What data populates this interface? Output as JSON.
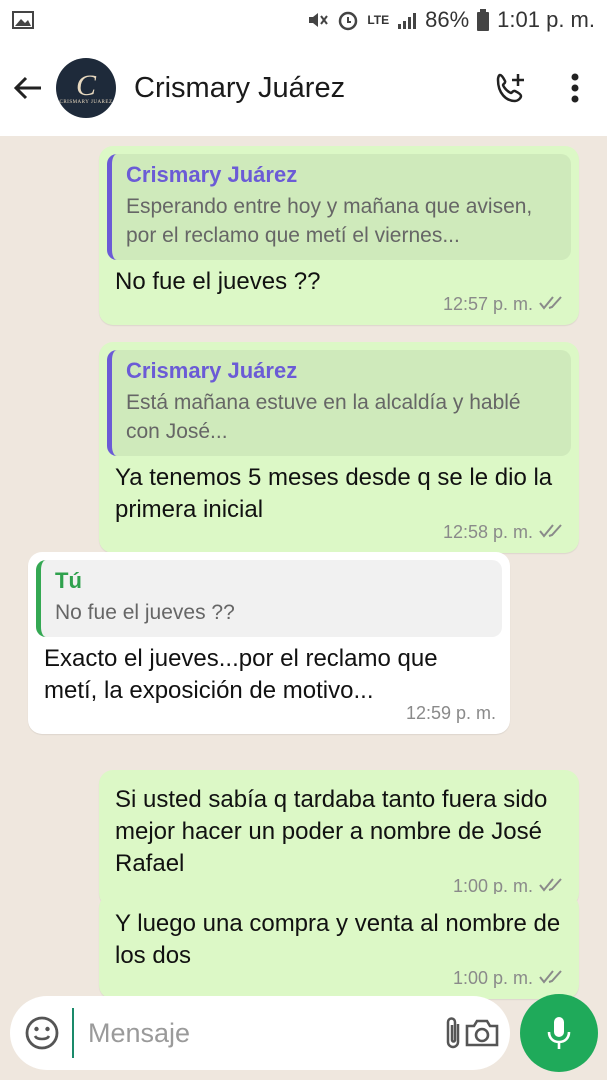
{
  "status_bar": {
    "battery": "86%",
    "time": "1:01 p. m.",
    "network": "LTE"
  },
  "header": {
    "contact_name": "Crismary Juárez",
    "avatar_initial": "C",
    "avatar_text": "CRISMARY JUAREZ"
  },
  "messages": [
    {
      "quote_author": "Crismary Juárez",
      "quote_text": "Esperando entre hoy y mañana que avisen, por el reclamo que metí el viernes...",
      "text": "No fue el jueves ??",
      "time": "12:57 p. m."
    },
    {
      "quote_author": "Crismary Juárez",
      "quote_text": "Está mañana estuve en la alcaldía y hablé con José...",
      "text": "Ya tenemos 5 meses desde q se le dio la primera inicial",
      "time": "12:58 p. m."
    },
    {
      "quote_author": "Tú",
      "quote_text": "No fue el jueves ??",
      "text": "Exacto el jueves...por el reclamo que metí, la exposición de motivo...",
      "time": "12:59 p. m."
    },
    {
      "text": "Si usted sabía q tardaba tanto fuera sido mejor hacer un poder a nombre de José Rafael",
      "time": "1:00 p. m."
    },
    {
      "text": "Y luego una compra y venta al nombre de los dos",
      "time": "1:00 p. m."
    }
  ],
  "input": {
    "placeholder": "Mensaje"
  },
  "colors": {
    "outgoing_bubble": "#dcf8c6",
    "incoming_bubble": "#ffffff",
    "accent_green": "#1faa5a",
    "quote_purple": "#6b5bd6"
  }
}
